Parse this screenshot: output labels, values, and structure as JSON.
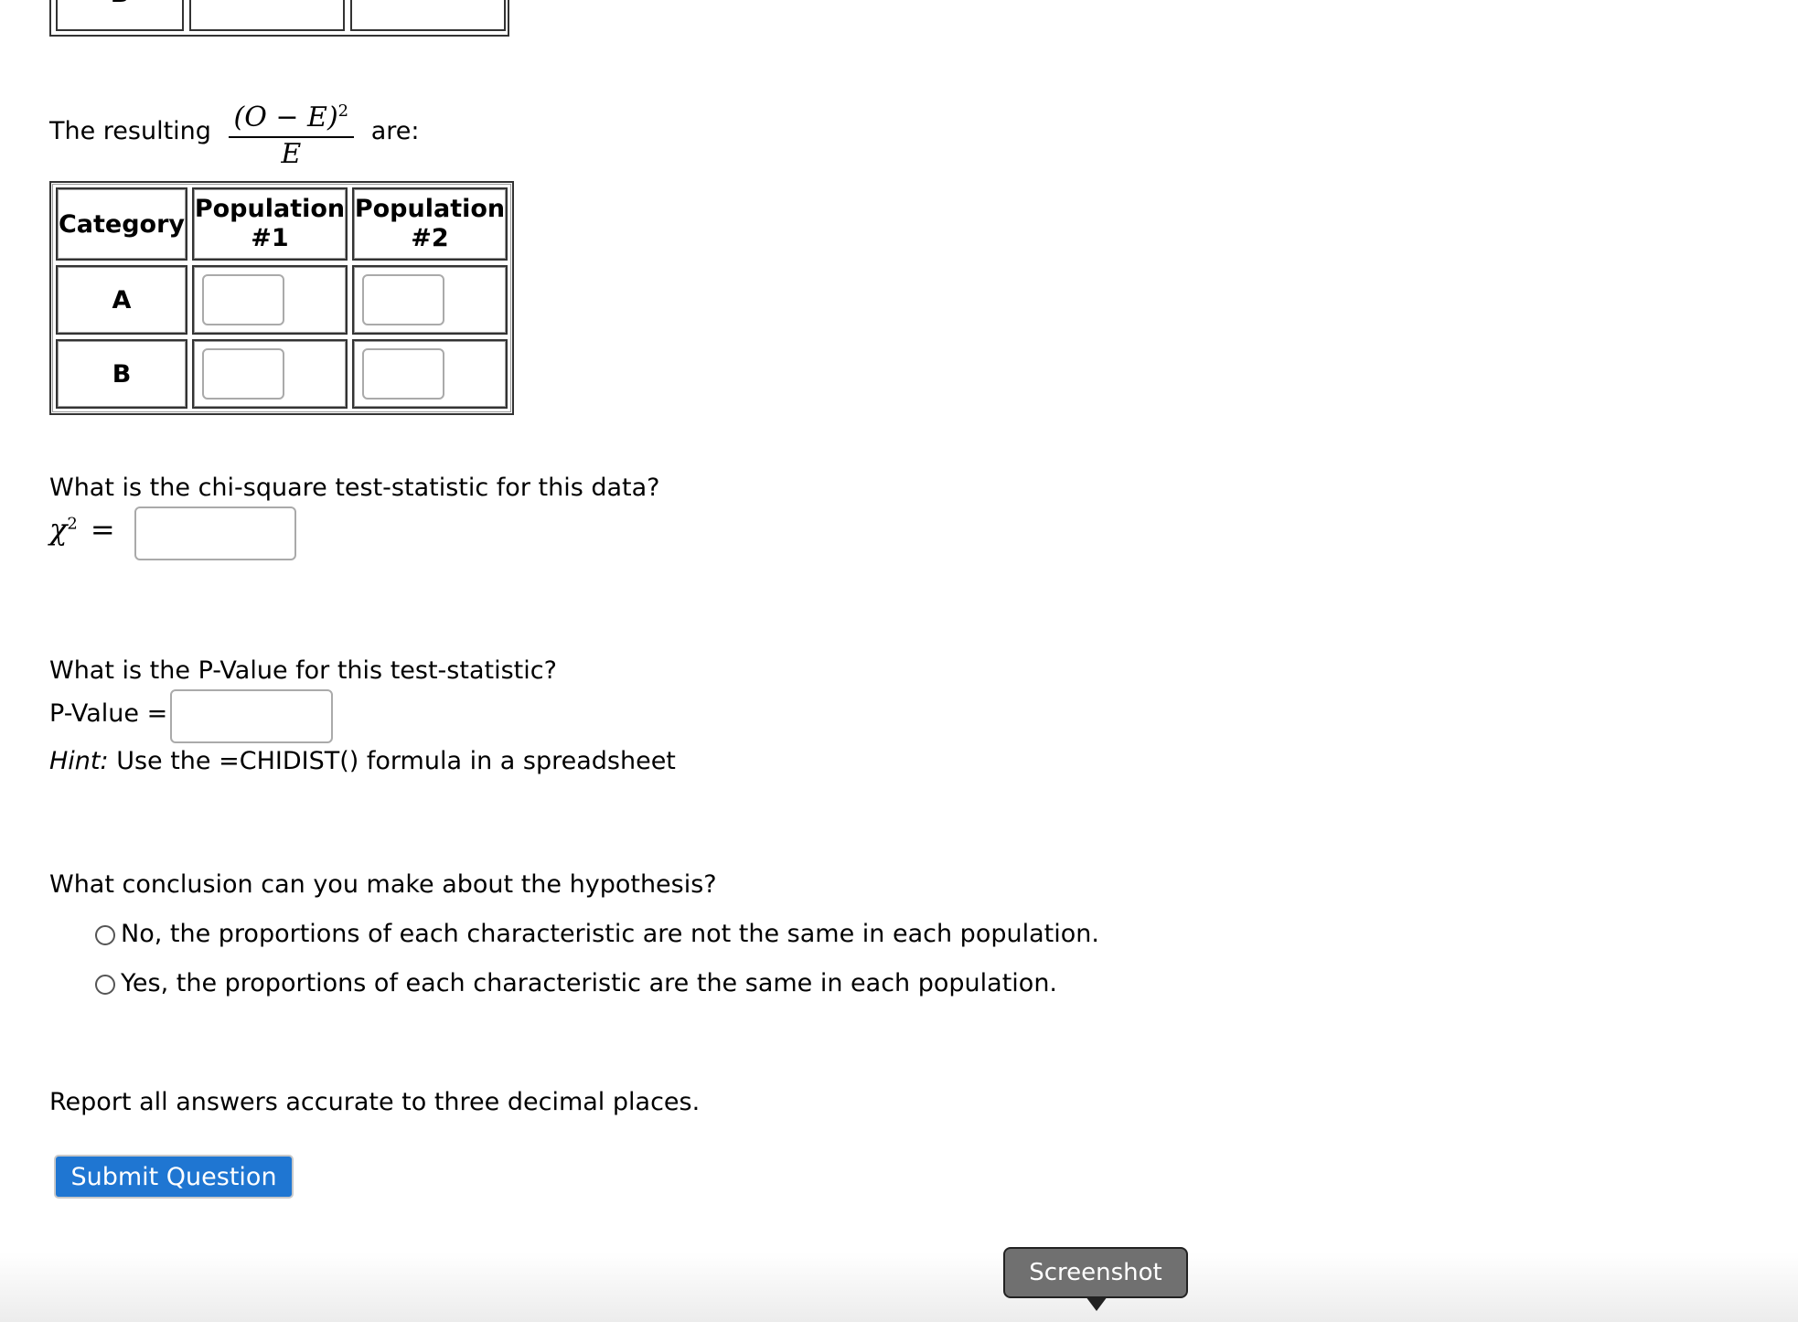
{
  "top_table": {
    "partial_row_label": "B"
  },
  "resulting": {
    "prefix": "The resulting",
    "numerator": "(O − E)",
    "exponent": "2",
    "denominator": "E",
    "suffix": "are:"
  },
  "table": {
    "headers": [
      "Category",
      "Population #1",
      "Population #2"
    ],
    "rows": [
      {
        "label": "A",
        "values": [
          "",
          ""
        ]
      },
      {
        "label": "B",
        "values": [
          "",
          ""
        ]
      }
    ]
  },
  "chi": {
    "question": "What is the chi-square test-statistic for this data?",
    "symbol": "χ",
    "exponent": "2",
    "equals": "=",
    "value": ""
  },
  "pvalue": {
    "question": "What is the P-Value for this test-statistic?",
    "label": "P-Value =",
    "value": "",
    "hint_label": "Hint:",
    "hint_text": " Use the =CHIDIST() formula in a spreadsheet"
  },
  "conclusion": {
    "question": "What conclusion can you make about the hypothesis?",
    "options": [
      "No, the proportions of each characteristic are not the same in each population.",
      "Yes, the proportions of each characteristic are the same in each population."
    ]
  },
  "report": "Report all answers accurate to three decimal places.",
  "submit_label": "Submit Question",
  "tooltip": "Screenshot",
  "colors": {
    "submit_bg": "#1f76d2",
    "tooltip_bg": "#707070"
  }
}
